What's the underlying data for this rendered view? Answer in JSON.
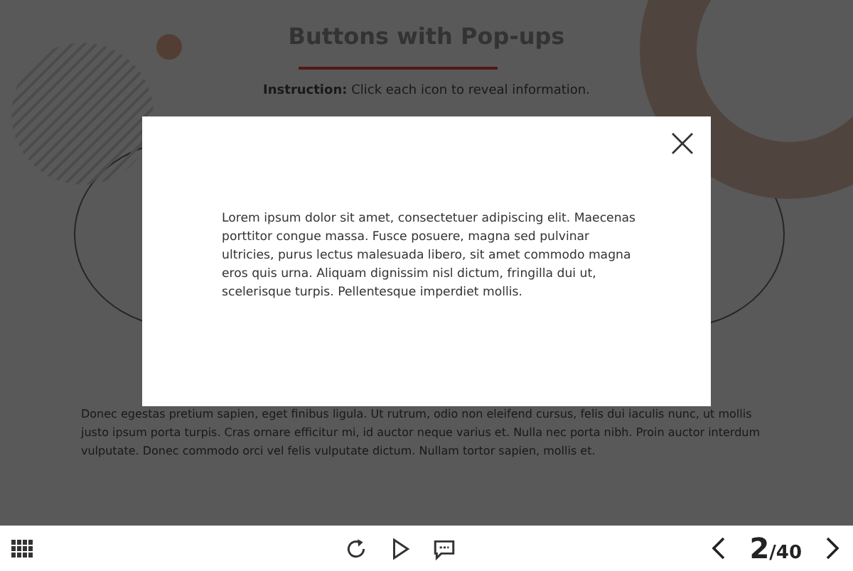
{
  "slide": {
    "title": "Buttons with Pop-ups",
    "instruction": "**Instruction:** Click each icon to reveal information.",
    "body": "Donec egestas pretium sapien, eget finibus ligula. Ut rutrum, odio non eleifend cursus, felis dui iaculis nunc, ut mollis justo ipsum porta turpis. Cras ornare efficitur mi, id auctor neque varius et. Nulla nec porta nibh. Proin auctor interdum vulputate. Donec commodo orci vel felis vulputate dictum. Nullam tortor sapien, mollis et."
  },
  "popup": {
    "text": "Lorem ipsum dolor sit amet, consectetuer adipiscing elit. Maecenas porttitor congue massa. Fusce posuere, magna sed pulvinar ultricies, purus lectus malesuada libero, sit amet commodo magna eros quis urna. Aliquam dignissim nisl dictum, fringilla dui ut, scelerisque turpis. Pellentesque imperdiet mollis."
  },
  "player": {
    "page_current": "2",
    "page_total": "/40"
  }
}
